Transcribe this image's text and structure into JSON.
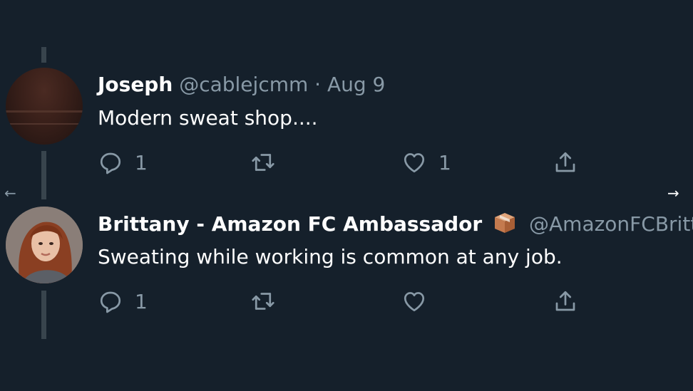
{
  "tweets": [
    {
      "display_name": "Joseph",
      "handle": "@cablejcmm",
      "separator": "·",
      "date": "Aug 9",
      "text": "Modern sweat shop....",
      "reply_count": "1",
      "retweet_count": "",
      "like_count": "1",
      "avatar_icon": "user-avatar-dark"
    },
    {
      "display_name": "Brittany - Amazon FC Ambassador",
      "badge_icon": "package-box-icon",
      "handle": "@AmazonFCBritt",
      "text": "Sweating while working is common at any job.",
      "reply_count": "1",
      "retweet_count": "",
      "like_count": "",
      "avatar_icon": "user-avatar-photo"
    }
  ],
  "nav": {
    "left_arrow": "←",
    "right_arrow": "→"
  },
  "colors": {
    "background": "#15202b",
    "text_primary": "#ffffff",
    "text_muted": "#8899a6",
    "thread_line": "#38444d"
  }
}
